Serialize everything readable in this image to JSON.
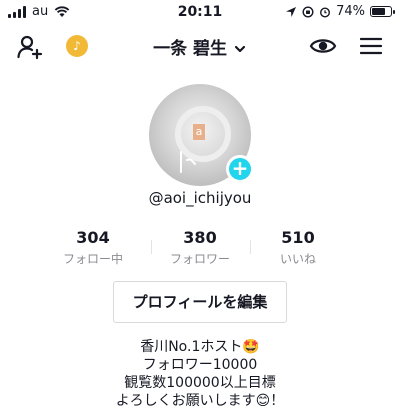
{
  "status_bar": {
    "carrier": "au",
    "time": "20:11",
    "battery": "74%",
    "battery_level": 0.74
  },
  "header": {
    "username_display": "一条 碧生"
  },
  "profile": {
    "handle": "@aoi_ichijyou",
    "avatar_label": "a",
    "stats": [
      {
        "value": "304",
        "label": "フォロー中"
      },
      {
        "value": "380",
        "label": "フォロワー"
      },
      {
        "value": "510",
        "label": "いいね"
      }
    ],
    "edit_button": "プロフィールを編集",
    "bio": [
      "香川No.1ホスト🤩",
      "フォロワー10000",
      "観覧数100000以上目標",
      "よろしくお願いします😊！"
    ]
  }
}
